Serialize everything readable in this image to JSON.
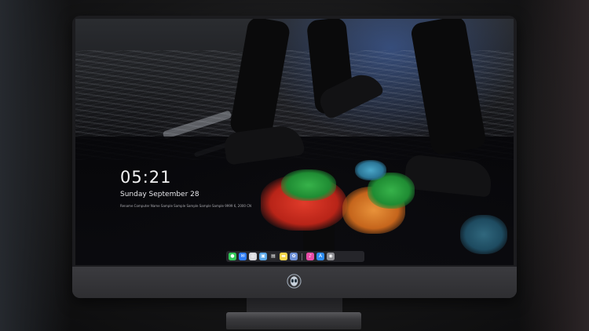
{
  "lock_screen": {
    "time": "05:21",
    "date": "Sunday September  28",
    "info_line": "Rename Computer Name Sample Sample Sample Sample Sample 9999 6, 2000 CN"
  },
  "dock": {
    "icons": [
      {
        "name": "messages-icon",
        "glyph": "●",
        "color": "#34c759"
      },
      {
        "name": "mail-icon",
        "glyph": "✉",
        "color": "#2f7cf6"
      },
      {
        "name": "safari-icon",
        "glyph": "◎",
        "color": "#d9d9de"
      },
      {
        "name": "finder-icon",
        "glyph": "▣",
        "color": "#5aa7e8"
      },
      {
        "name": "clapper-icon",
        "glyph": "▤",
        "color": "#2a2a2e"
      },
      {
        "name": "notes-icon",
        "glyph": "▬",
        "color": "#f5d54a"
      },
      {
        "name": "photos-icon",
        "glyph": "✿",
        "color": "#6d8fd6"
      },
      {
        "name": "music-icon",
        "glyph": "♪",
        "color": "#e94ca7"
      },
      {
        "name": "appstore-icon",
        "glyph": "A",
        "color": "#2d8cf0"
      },
      {
        "name": "camera-icon",
        "glyph": "◉",
        "color": "#8e8e93"
      }
    ]
  },
  "colors": {
    "accent_blue": "#2f7cf6",
    "bezel": "#1c1c1f",
    "chin": "#3b3b3f"
  }
}
